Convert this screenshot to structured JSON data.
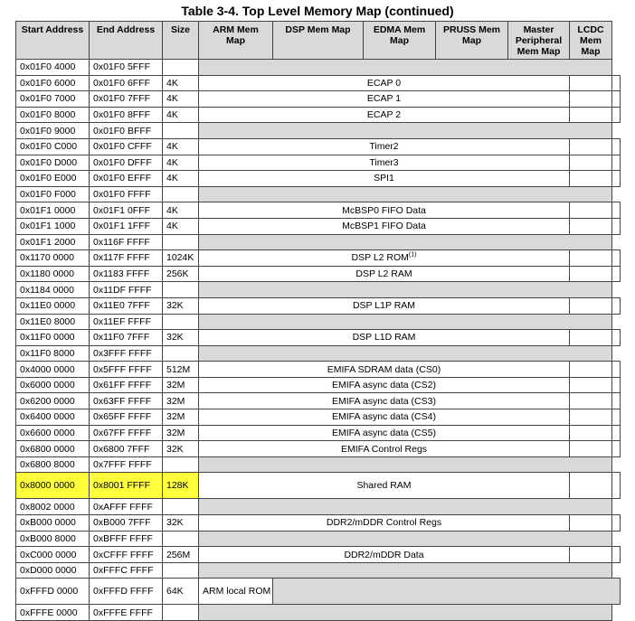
{
  "title": "Table 3-4. Top Level Memory Map (continued)",
  "headers": {
    "start": "Start Address",
    "end": "End Address",
    "size": "Size",
    "arm": "ARM Mem Map",
    "dsp": "DSP Mem Map",
    "edma": "EDMA Mem Map",
    "pruss": "PRUSS Mem Map",
    "master": "Master Peripheral Mem Map",
    "lcdc": "LCDC Mem Map"
  },
  "rows": [
    {
      "start": "0x01F0 4000",
      "end": "0x01F0 5FFF",
      "size": "",
      "desc": ""
    },
    {
      "start": "0x01F0 6000",
      "end": "0x01F0 6FFF",
      "size": "4K",
      "desc": "ECAP 0"
    },
    {
      "start": "0x01F0 7000",
      "end": "0x01F0 7FFF",
      "size": "4K",
      "desc": "ECAP 1"
    },
    {
      "start": "0x01F0 8000",
      "end": "0x01F0 8FFF",
      "size": "4K",
      "desc": "ECAP 2"
    },
    {
      "start": "0x01F0 9000",
      "end": "0x01F0 BFFF",
      "size": "",
      "desc": ""
    },
    {
      "start": "0x01F0 C000",
      "end": "0x01F0 CFFF",
      "size": "4K",
      "desc": "Timer2"
    },
    {
      "start": "0x01F0 D000",
      "end": "0x01F0 DFFF",
      "size": "4K",
      "desc": "Timer3"
    },
    {
      "start": "0x01F0 E000",
      "end": "0x01F0 EFFF",
      "size": "4K",
      "desc": "SPI1"
    },
    {
      "start": "0x01F0 F000",
      "end": "0x01F0 FFFF",
      "size": "",
      "desc": ""
    },
    {
      "start": "0x01F1 0000",
      "end": "0x01F1 0FFF",
      "size": "4K",
      "desc": "McBSP0 FIFO Data"
    },
    {
      "start": "0x01F1 1000",
      "end": "0x01F1 1FFF",
      "size": "4K",
      "desc": "McBSP1 FIFO Data"
    },
    {
      "start": "0x01F1 2000",
      "end": "0x116F FFFF",
      "size": "",
      "desc": ""
    },
    {
      "start": "0x1170 0000",
      "end": "0x117F FFFF",
      "size": "1024K",
      "desc": "DSP L2 ROM",
      "sup": "(1)"
    },
    {
      "start": "0x1180 0000",
      "end": "0x1183 FFFF",
      "size": "256K",
      "desc": "DSP L2 RAM"
    },
    {
      "start": "0x1184 0000",
      "end": "0x11DF FFFF",
      "size": "",
      "desc": ""
    },
    {
      "start": "0x11E0 0000",
      "end": "0x11E0 7FFF",
      "size": "32K",
      "desc": "DSP L1P RAM"
    },
    {
      "start": "0x11E0 8000",
      "end": "0x11EF FFFF",
      "size": "",
      "desc": ""
    },
    {
      "start": "0x11F0 0000",
      "end": "0x11F0 7FFF",
      "size": "32K",
      "desc": "DSP L1D RAM"
    },
    {
      "start": "0x11F0 8000",
      "end": "0x3FFF FFFF",
      "size": "",
      "desc": ""
    },
    {
      "start": "0x4000 0000",
      "end": "0x5FFF FFFF",
      "size": "512M",
      "desc": "EMIFA SDRAM data (CS0)"
    },
    {
      "start": "0x6000 0000",
      "end": "0x61FF FFFF",
      "size": "32M",
      "desc": "EMIFA async data (CS2)"
    },
    {
      "start": "0x6200 0000",
      "end": "0x63FF FFFF",
      "size": "32M",
      "desc": "EMIFA async data (CS3)"
    },
    {
      "start": "0x6400 0000",
      "end": "0x65FF FFFF",
      "size": "32M",
      "desc": "EMIFA async data (CS4)"
    },
    {
      "start": "0x6600 0000",
      "end": "0x67FF FFFF",
      "size": "32M",
      "desc": "EMIFA async data (CS5)"
    },
    {
      "start": "0x6800 0000",
      "end": "0x6800 7FFF",
      "size": "32K",
      "desc": "EMIFA Control Regs"
    },
    {
      "start": "0x6800 8000",
      "end": "0x7FFF FFFF",
      "size": "",
      "desc": ""
    },
    {
      "start": "0x8000 0000",
      "end": "0x8001 FFFF",
      "size": "128K",
      "desc": "Shared RAM",
      "highlight": true,
      "tall": true
    },
    {
      "start": "0x8002 0000",
      "end": "0xAFFF FFFF",
      "size": "",
      "desc": ""
    },
    {
      "start": "0xB000 0000",
      "end": "0xB000 7FFF",
      "size": "32K",
      "desc": "DDR2/mDDR Control Regs"
    },
    {
      "start": "0xB000 8000",
      "end": "0xBFFF FFFF",
      "size": "",
      "desc": ""
    },
    {
      "start": "0xC000 0000",
      "end": "0xCFFF FFFF",
      "size": "256M",
      "desc": "DDR2/mDDR Data"
    },
    {
      "start": "0xD000 0000",
      "end": "0xFFFC FFFF",
      "size": "",
      "desc": ""
    },
    {
      "start": "0xFFFD 0000",
      "end": "0xFFFD FFFF",
      "size": "64K",
      "desc": "ARM local ROM",
      "armOnly": true,
      "tall": true
    },
    {
      "start": "0xFFFE 0000",
      "end": "0xFFFE FFFF",
      "size": "",
      "desc": ""
    }
  ],
  "colors": {
    "header_bg": "#d9d9d9",
    "reserved_bg": "#d9d9d9",
    "highlight": "#ffff3c"
  }
}
